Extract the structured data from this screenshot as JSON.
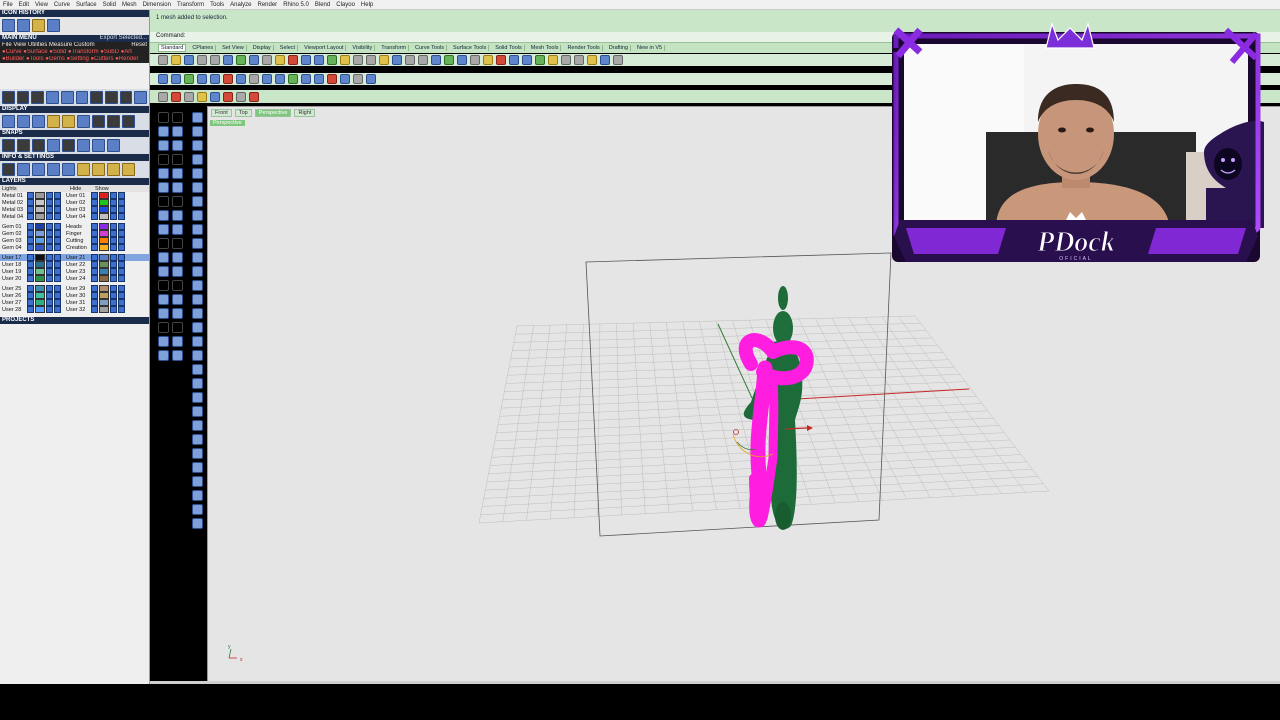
{
  "menu": [
    "File",
    "Edit",
    "View",
    "Curve",
    "Surface",
    "Solid",
    "Mesh",
    "Dimension",
    "Transform",
    "Tools",
    "Analyze",
    "Render",
    "Rhino 5.0",
    "Blend",
    "Clayoo",
    "Help"
  ],
  "left_panel": {
    "icon_history": "ICON HISTORY",
    "main_menu": "MAIN MENU",
    "export_label": "Export Selected...",
    "menu_row1": "File  View  Utilities  Measure  Custom",
    "reset_label": "Reset",
    "menu_row2": "●Curve ●Surface ●Solid ●Transform ●SubD ●Art",
    "menu_row3": "●Builder ●Tools ●Gems ●Setting ●Cutters ●Render",
    "display": "DISPLAY",
    "snaps": "SNAPS",
    "info_settings": "INFO & SETTINGS",
    "layers": "LAYERS",
    "projects": "PROJECTS",
    "layer_header_left": "Lights",
    "layer_header_mid": "Hide",
    "layer_header_right": "Show",
    "layers_left": [
      "Metal 01",
      "Metal 02",
      "Metal 03",
      "Metal 04",
      "",
      "Gem 01",
      "Gem 02",
      "Gem 03",
      "Gem 04",
      "",
      "User 17",
      "User 18",
      "User 19",
      "User 20",
      "",
      "User 25",
      "User 26",
      "User 27",
      "User 28"
    ],
    "layers_right": [
      "User 01",
      "User 02",
      "User 03",
      "User 04",
      "",
      "Heads",
      "Finger",
      "Cutting",
      "Creation",
      "",
      "User 21",
      "User 22",
      "User 23",
      "User 24",
      "",
      "User 29",
      "User 30",
      "User 31",
      "User 32"
    ],
    "layer_colors_left": [
      "#9a9a9a",
      "#c8c8c8",
      "#bdbdbd",
      "#a0a0a0",
      "",
      "#1f3fa8",
      "#7d9fd8",
      "#5aa0e0",
      "#3558c0",
      "",
      "#111111",
      "#2a6f8f",
      "#6fbf8f",
      "#2c8f4a",
      "",
      "#3f8fb0",
      "#40c0a0",
      "#30b080",
      "#55a0ff"
    ],
    "layer_colors_right": [
      "#e02020",
      "#22c022",
      "#1f4fe0",
      "#c0c0c0",
      "",
      "#8b2be2",
      "#d040d0",
      "#ff7f00",
      "#ffb020",
      "",
      "#5a7fc7",
      "#6a8f5a",
      "#3b7fb0",
      "#8a6a40",
      "",
      "#b09070",
      "#c0a060",
      "#7fa0c0",
      "#a0a0a0"
    ]
  },
  "command": {
    "history_text": "1 mesh added to selection.",
    "prompt": "Command:"
  },
  "toolbar_tabs": [
    "Standard",
    "CPlanes",
    "Set View",
    "Display",
    "Select",
    "Viewport Layout",
    "Visibility",
    "Transform",
    "Curve Tools",
    "Surface Tools",
    "Solid Tools",
    "Mesh Tools",
    "Render Tools",
    "Drafting",
    "New in V5"
  ],
  "viewport": {
    "tabs": [
      "Front",
      "Top",
      "Perspective",
      "Right"
    ],
    "active_tab": "Perspective",
    "label": "Perspective",
    "axis_x": "x",
    "axis_y": "y"
  },
  "webcam": {
    "brand": "PDock",
    "brand_sub": "OFICIAL",
    "accent": "#8a2be2"
  },
  "colors": {
    "magenta_object": "#ff1ee0",
    "green_object": "#1e6b3a",
    "x_axis": "#c62828",
    "y_axis": "#2e7d32",
    "cmd_green": "#c9e6c9"
  }
}
